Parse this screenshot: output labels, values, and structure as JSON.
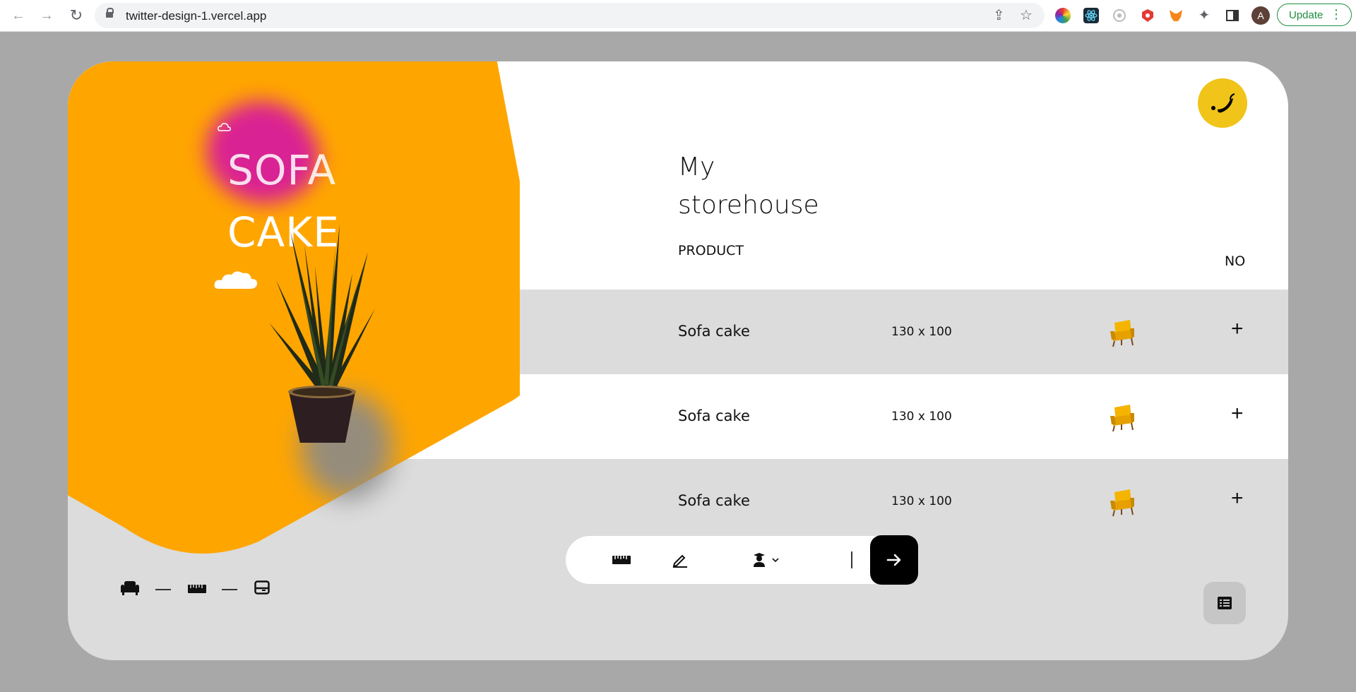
{
  "browser": {
    "url": "twitter-design-1.vercel.app",
    "avatar_letter": "A",
    "update_label": "Update",
    "update_menu": "⋮"
  },
  "hero": {
    "title_line1": "SOFA",
    "title_line2": "CAKE"
  },
  "header": {
    "title_line1": "My",
    "title_line2": "storehouse"
  },
  "table": {
    "columns": [
      "PRODUCT",
      "NO"
    ],
    "rows": [
      {
        "name": "Sofa cake",
        "size": "130 x 100",
        "action": "+"
      },
      {
        "name": "Sofa cake",
        "size": "130 x 100",
        "action": "+"
      },
      {
        "name": "Sofa cake",
        "size": "130 x 100",
        "action": "+"
      }
    ]
  },
  "colors": {
    "accent_orange": "#FFA500",
    "logo_yellow": "#F0C419",
    "card_bg": "#DCDCDC",
    "page_bg": "#A8A8A8"
  },
  "icons": {
    "pager": [
      "sofa-icon",
      "ruler-icon",
      "panel-icon"
    ],
    "toolbar": [
      "ruler-icon",
      "pencil-icon",
      "user-graduate-icon",
      "chevron-down-icon"
    ],
    "go": "arrow-right-icon",
    "menu": "list-icon"
  }
}
